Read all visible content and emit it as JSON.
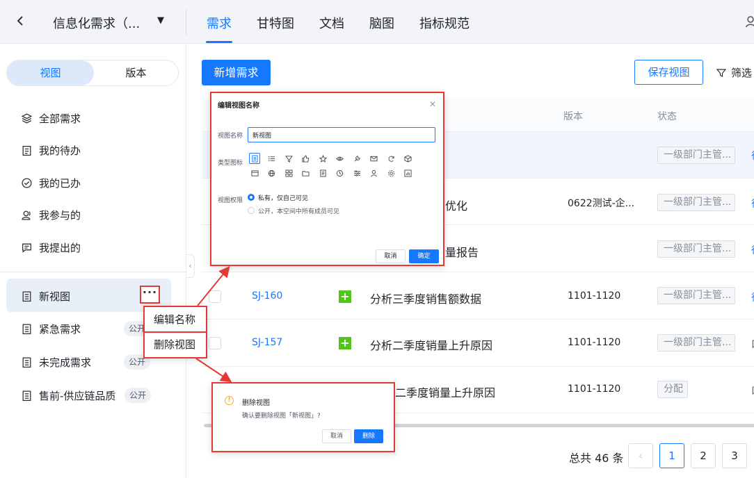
{
  "header": {
    "back_icon": "chevron-left-icon",
    "project_name": "信息化需求（...",
    "tabs": [
      {
        "label": "需求",
        "active": true
      },
      {
        "label": "甘特图",
        "active": false
      },
      {
        "label": "文档",
        "active": false
      },
      {
        "label": "脑图",
        "active": false
      },
      {
        "label": "指标规范",
        "active": false
      }
    ],
    "accent_color": "#1677ff"
  },
  "sidebar": {
    "segments": [
      "视图",
      "版本"
    ],
    "system_views": [
      {
        "label": "全部需求",
        "icon": "layers-icon"
      },
      {
        "label": "我的待办",
        "icon": "clipboard-icon"
      },
      {
        "label": "我的已办",
        "icon": "check-circle-icon"
      },
      {
        "label": "我参与的",
        "icon": "user-group-icon"
      },
      {
        "label": "我提出的",
        "icon": "message-icon"
      }
    ],
    "custom_views": [
      {
        "label": "新视图",
        "badge": "",
        "active": true
      },
      {
        "label": "紧急需求",
        "badge": "公开"
      },
      {
        "label": "未完成需求",
        "badge": "公开"
      },
      {
        "label": "售前-供应链品质",
        "badge": "公开"
      }
    ],
    "more_label": "···"
  },
  "context_menu": {
    "items": [
      "编辑名称",
      "删除视图"
    ]
  },
  "toolbar": {
    "add_label": "新增需求",
    "save_view_label": "保存视图",
    "filter_label": "筛选"
  },
  "table": {
    "headers": [
      "版本",
      "状态"
    ],
    "rows": [
      {
        "id": "",
        "title": "",
        "version": "",
        "status": "一级部门主管...",
        "edge": "待"
      },
      {
        "id": "",
        "title": "优化",
        "version": "0622测试-企...",
        "status": "一级部门主管...",
        "edge": "待"
      },
      {
        "id": "",
        "title": "量报告",
        "version": "",
        "status": "一级部门主管...",
        "edge": "待"
      },
      {
        "id": "SJ-160",
        "title": "分析三季度销售额数据",
        "version": "1101-1120",
        "status": "一级部门主管...",
        "edge": "待"
      },
      {
        "id": "SJ-157",
        "title": "分析二季度销量上升原因",
        "version": "1101-1120",
        "status": "一级部门主管...",
        "edge": "口"
      },
      {
        "id": "",
        "title": "二季度销量上升原因",
        "version": "1101-1120",
        "status": "分配",
        "edge": "口"
      }
    ]
  },
  "pagination": {
    "total_text": "总共 46 条",
    "pages": [
      "1",
      "2",
      "3"
    ],
    "current": "1"
  },
  "edit_dialog": {
    "title": "编辑视图名称",
    "name_label": "视图名称",
    "name_value": "新视图",
    "type_label": "类型图标",
    "icons_row1": [
      "list-icon",
      "bullet-list-icon",
      "filter-icon",
      "thumbs-up-icon",
      "star-icon",
      "eye-icon",
      "wrench-icon",
      "mail-icon",
      "refresh-icon",
      "cube-icon"
    ],
    "icons_row2": [
      "window-icon",
      "globe-icon",
      "grid-icon",
      "folder-icon",
      "document-icon",
      "clock-icon",
      "sliders-icon",
      "person-icon",
      "settings-icon",
      "chart-icon"
    ],
    "perm_label": "视图权限",
    "perm_options": [
      "私有，仅自己可见",
      "公开，本空间中所有成员可见"
    ],
    "cancel_label": "取消",
    "ok_label": "确定"
  },
  "delete_dialog": {
    "title": "删除视图",
    "message": "确认要删除视图「新视图」?",
    "cancel_label": "取消",
    "ok_label": "删除"
  },
  "annotation_color": "#e53935"
}
